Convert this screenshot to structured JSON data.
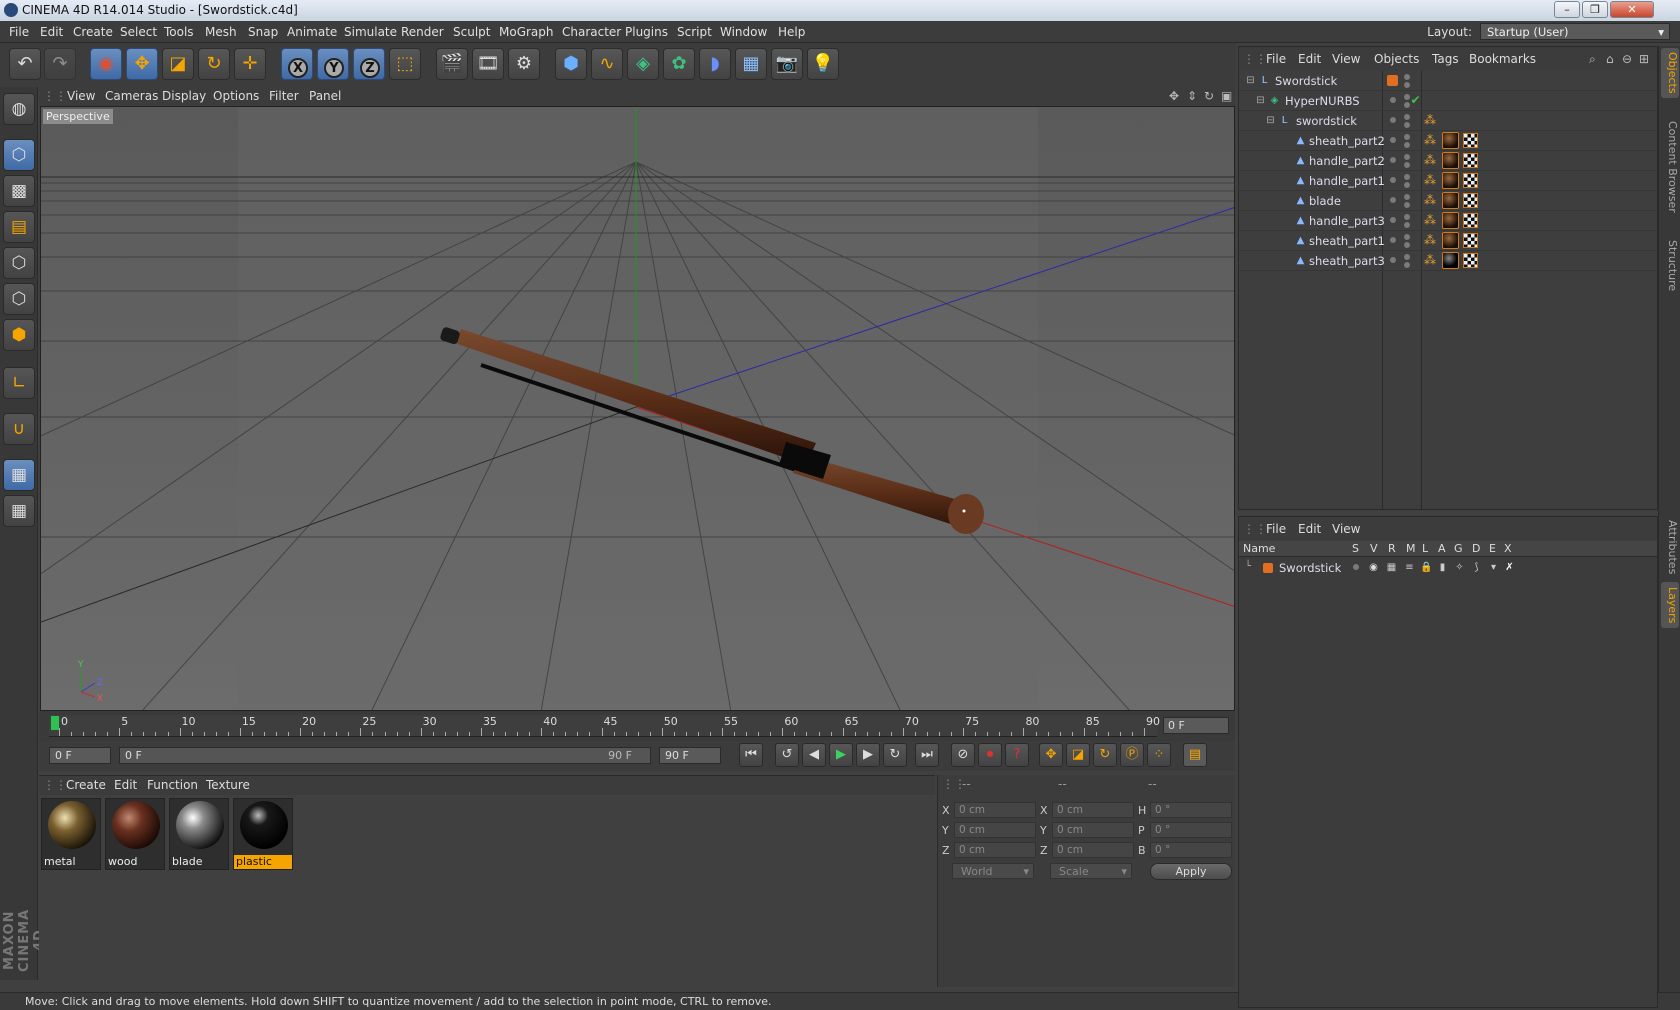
{
  "window": {
    "title": "CINEMA 4D R14.014 Studio - [Swordstick.c4d]",
    "min": "–",
    "max": "❐",
    "close": "✕"
  },
  "menubar": {
    "items": [
      "File",
      "Edit",
      "Create",
      "Select",
      "Tools",
      "Mesh",
      "Snap",
      "Animate",
      "Simulate",
      "Render",
      "Sculpt",
      "MoGraph",
      "Character",
      "Plugins",
      "Script",
      "Window",
      "Help"
    ],
    "layout_label": "Layout:",
    "layout_value": "Startup (User)"
  },
  "toolbar": {
    "axis": [
      "X",
      "Y",
      "Z"
    ]
  },
  "viewport": {
    "menu": [
      "View",
      "Cameras",
      "Display",
      "Options",
      "Filter",
      "Panel"
    ],
    "label": "Perspective"
  },
  "timeline": {
    "ticks": [
      "0",
      "5",
      "10",
      "15",
      "20",
      "25",
      "30",
      "35",
      "40",
      "45",
      "50",
      "55",
      "60",
      "65",
      "70",
      "75",
      "80",
      "85",
      "90"
    ],
    "current": "0 F"
  },
  "transport": {
    "start": "0 F",
    "range_start": "0 F",
    "range_end": "90 F",
    "end": "90 F"
  },
  "materials": {
    "menu": [
      "Create",
      "Edit",
      "Function",
      "Texture"
    ],
    "items": [
      {
        "name": "metal",
        "color": "#6a5030"
      },
      {
        "name": "wood",
        "color": "#5a2c18"
      },
      {
        "name": "blade",
        "color": "#8a8a8a"
      },
      {
        "name": "plastic",
        "color": "#0a0a0a"
      }
    ]
  },
  "coordinates": {
    "header": [
      "--",
      "--",
      "--"
    ],
    "rows": [
      {
        "a": "X",
        "v1": "0 cm",
        "b": "X",
        "v2": "0 cm",
        "c": "H",
        "v3": "0 °"
      },
      {
        "a": "Y",
        "v1": "0 cm",
        "b": "Y",
        "v2": "0 cm",
        "c": "P",
        "v3": "0 °"
      },
      {
        "a": "Z",
        "v1": "0 cm",
        "b": "Z",
        "v2": "0 cm",
        "c": "B",
        "v3": "0 °"
      }
    ],
    "space": "World",
    "mode": "Scale",
    "apply": "Apply"
  },
  "status": "Move: Click and drag to move elements. Hold down SHIFT to quantize movement / add to the selection in point mode, CTRL to remove.",
  "objects": {
    "menu": [
      "File",
      "Edit",
      "View",
      "Objects",
      "Tags",
      "Bookmarks"
    ],
    "items": [
      {
        "name": "Swordstick",
        "level": 0
      },
      {
        "name": "HyperNURBS",
        "level": 1
      },
      {
        "name": "swordstick",
        "level": 2
      },
      {
        "name": "sheath_part2",
        "level": 3
      },
      {
        "name": "handle_part2",
        "level": 3
      },
      {
        "name": "handle_part1",
        "level": 3
      },
      {
        "name": "blade",
        "level": 3
      },
      {
        "name": "handle_part3",
        "level": 3
      },
      {
        "name": "sheath_part1",
        "level": 3
      },
      {
        "name": "sheath_part3",
        "level": 3
      }
    ]
  },
  "layers": {
    "menu": [
      "File",
      "Edit",
      "View"
    ],
    "columns": [
      "Name",
      "S",
      "V",
      "R",
      "M",
      "L",
      "A",
      "G",
      "D",
      "E",
      "X"
    ],
    "items": [
      {
        "name": "Swordstick",
        "color": "#e07020"
      }
    ]
  },
  "right_tabs": [
    "Objects",
    "Content Browser",
    "Structure",
    "Attributes",
    "Layers"
  ],
  "branding": "MAXON CINEMA 4D"
}
